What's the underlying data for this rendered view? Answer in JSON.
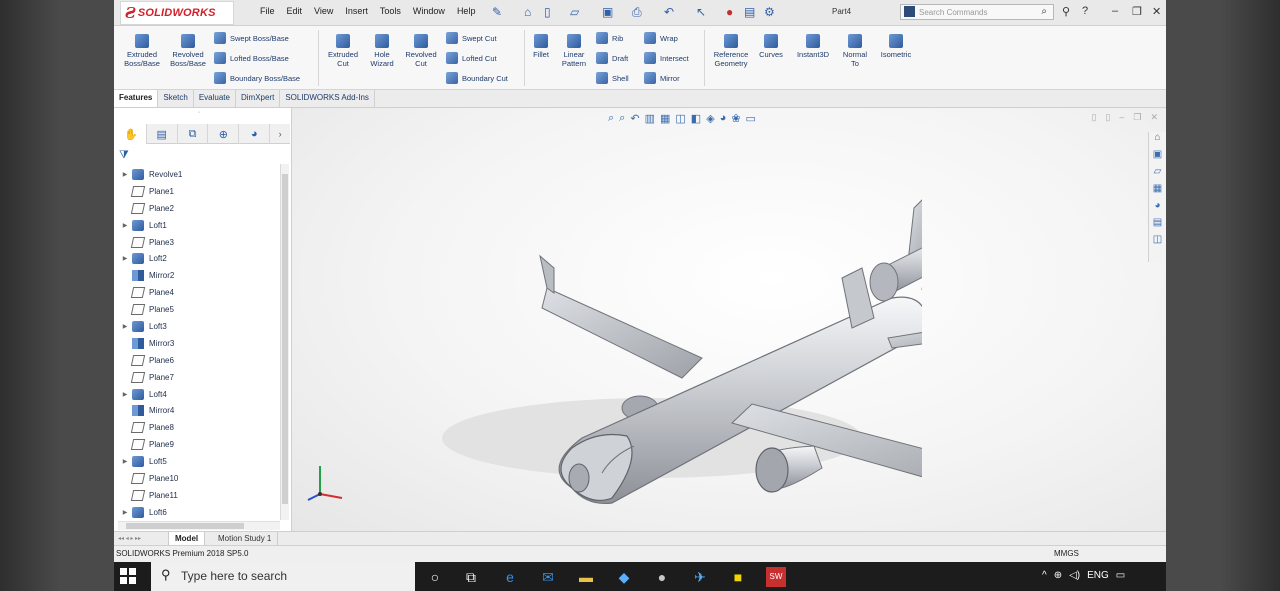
{
  "app": {
    "logo_brand": "SOLIDWORKS",
    "doc_title": "Part4",
    "search_placeholder": "Search Commands"
  },
  "menus": [
    "File",
    "Edit",
    "View",
    "Insert",
    "Tools",
    "Window",
    "Help"
  ],
  "ribbon": {
    "extruded_boss": "Extruded Boss/Base",
    "revolved_boss": "Revolved Boss/Base",
    "swept_boss": "Swept Boss/Base",
    "lofted_boss": "Lofted Boss/Base",
    "boundary_boss": "Boundary Boss/Base",
    "extruded_cut": "Extruded Cut",
    "hole_wizard": "Hole Wizard",
    "revolved_cut": "Revolved Cut",
    "swept_cut": "Swept Cut",
    "lofted_cut": "Lofted Cut",
    "boundary_cut": "Boundary Cut",
    "fillet": "Fillet",
    "linear_pattern": "Linear Pattern",
    "rib": "Rib",
    "draft": "Draft",
    "shell": "Shell",
    "wrap": "Wrap",
    "intersect": "Intersect",
    "mirror": "Mirror",
    "reference_geometry": "Reference Geometry",
    "curves": "Curves",
    "instant3d": "Instant3D",
    "normal_to": "Normal To",
    "isometric": "Isometric"
  },
  "command_tabs": [
    "Features",
    "Sketch",
    "Evaluate",
    "DimXpert",
    "SOLIDWORKS Add-Ins"
  ],
  "feature_tree": [
    {
      "label": "Revolve1",
      "kind": "feat",
      "expandable": true
    },
    {
      "label": "Plane1",
      "kind": "plane",
      "expandable": false
    },
    {
      "label": "Plane2",
      "kind": "plane",
      "expandable": false
    },
    {
      "label": "Loft1",
      "kind": "feat",
      "expandable": true
    },
    {
      "label": "Plane3",
      "kind": "plane",
      "expandable": false
    },
    {
      "label": "Loft2",
      "kind": "feat",
      "expandable": true
    },
    {
      "label": "Mirror2",
      "kind": "mirror",
      "expandable": false
    },
    {
      "label": "Plane4",
      "kind": "plane",
      "expandable": false
    },
    {
      "label": "Plane5",
      "kind": "plane",
      "expandable": false
    },
    {
      "label": "Loft3",
      "kind": "feat",
      "expandable": true
    },
    {
      "label": "Mirror3",
      "kind": "mirror",
      "expandable": false
    },
    {
      "label": "Plane6",
      "kind": "plane",
      "expandable": false
    },
    {
      "label": "Plane7",
      "kind": "plane",
      "expandable": false
    },
    {
      "label": "Loft4",
      "kind": "feat",
      "expandable": true
    },
    {
      "label": "Mirror4",
      "kind": "mirror",
      "expandable": false
    },
    {
      "label": "Plane8",
      "kind": "plane",
      "expandable": false
    },
    {
      "label": "Plane9",
      "kind": "plane",
      "expandable": false
    },
    {
      "label": "Loft5",
      "kind": "feat",
      "expandable": true
    },
    {
      "label": "Plane10",
      "kind": "plane",
      "expandable": false
    },
    {
      "label": "Plane11",
      "kind": "plane",
      "expandable": false
    },
    {
      "label": "Loft6",
      "kind": "feat",
      "expandable": true
    }
  ],
  "bottom_tabs": {
    "model": "Model",
    "motion": "Motion Study 1"
  },
  "status": {
    "version": "SOLIDWORKS Premium 2018 SP5.0",
    "units": "MMGS"
  },
  "taskbar": {
    "search_placeholder": "Type here to search",
    "language": "ENG"
  },
  "colors": {
    "brand_red": "#d0202a",
    "accent_blue": "#2f5b9c",
    "taskbar": "#1c1c1c"
  }
}
